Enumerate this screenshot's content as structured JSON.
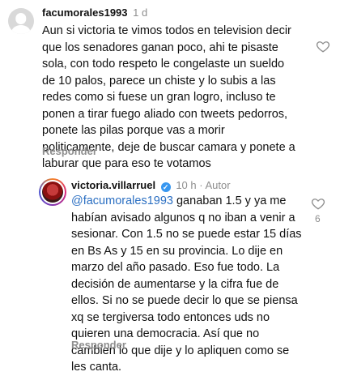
{
  "comment1": {
    "username": "facumorales1993",
    "time": "1 d",
    "text": "Aun si victoria te vimos todos en television decir\nque los senadores ganan poco, ahi te pisaste\nsola, con todo respeto le congelaste un sueldo\nde 10 palos, parece un chiste y lo subis a las\nredes como si fuese un gran logro, incluso te\nponen a tirar fuego aliado con tweets pedorros,\nponete las pilas porque vas a morir\npoliticamente, deje de buscar camara y ponete a\nlaburar que para eso te votamos",
    "reply_label": "Responder"
  },
  "comment2": {
    "username": "victoria.villarruel",
    "time": "10 h",
    "author_label": "Autor",
    "separator": "·",
    "mention": "@facumorales1993",
    "text": " ganaban 1.5 y ya me\nhabían avisado algunos q no iban a venir a\nsesionar. Con 1.5 no se puede estar 15 días\nen Bs As y 15 en su provincia. Lo dije en\nmarzo del año pasado. Eso fue todo. La\ndecisión de aumentarse y la cifra fue de\nellos. Si no se puede decir lo que se piensa\nxq se tergiversa todo entonces uds no\nquieren una democracia. Así que no\ncambien lo que dije y lo apliquen como se\nles canta.",
    "reply_label": "Responder",
    "like_count": "6"
  },
  "icons": {
    "heart": "heart-outline-icon",
    "verified": "verified-badge-icon"
  },
  "colors": {
    "mention": "#2b6fc2",
    "muted": "#8e8e8e",
    "verified": "#3897f0"
  }
}
